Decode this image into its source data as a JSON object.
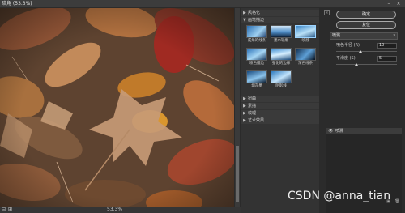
{
  "window": {
    "title": "暗角 (53.3%)",
    "minimize_label": "–",
    "close_label": "×"
  },
  "preview": {
    "zoom_minus": "⊟",
    "zoom_plus": "⊞",
    "zoom_label": "53.3%"
  },
  "gallery": {
    "categories_top": [
      {
        "arrow": "▶",
        "label": "风格化"
      },
      {
        "arrow": "▼",
        "label": "画笔描边"
      }
    ],
    "thumbnails": [
      {
        "label": "成角的线条",
        "selected": false
      },
      {
        "label": "墨水轮廓",
        "selected": false
      },
      {
        "label": "喷溅",
        "selected": true
      },
      {
        "label": "喷色描边",
        "selected": false
      },
      {
        "label": "强化的边缘",
        "selected": false
      },
      {
        "label": "深色线条",
        "selected": false
      },
      {
        "label": "烟灰墨",
        "selected": false
      },
      {
        "label": "阴影线",
        "selected": false
      }
    ],
    "categories_bottom": [
      {
        "arrow": "▶",
        "label": "扭曲"
      },
      {
        "arrow": "▶",
        "label": "素描"
      },
      {
        "arrow": "▶",
        "label": "纹理"
      },
      {
        "arrow": "▶",
        "label": "艺术效果"
      }
    ]
  },
  "controls": {
    "ok_label": "确定",
    "reset_label": "复位",
    "filter_select": "喷溅",
    "params": [
      {
        "label": "喷色半径 (R)",
        "value": "10",
        "fraction": 0.4
      },
      {
        "label": "平滑度 (S)",
        "value": "5",
        "fraction": 0.33
      }
    ]
  },
  "layers": {
    "items": [
      {
        "name": "喷溅"
      }
    ]
  },
  "watermark": "CSDN @anna_tian",
  "colors": {
    "panel_bg": "#2b2b2b",
    "gallery_bg": "#333333",
    "selected_border": "#9bd3ff"
  }
}
